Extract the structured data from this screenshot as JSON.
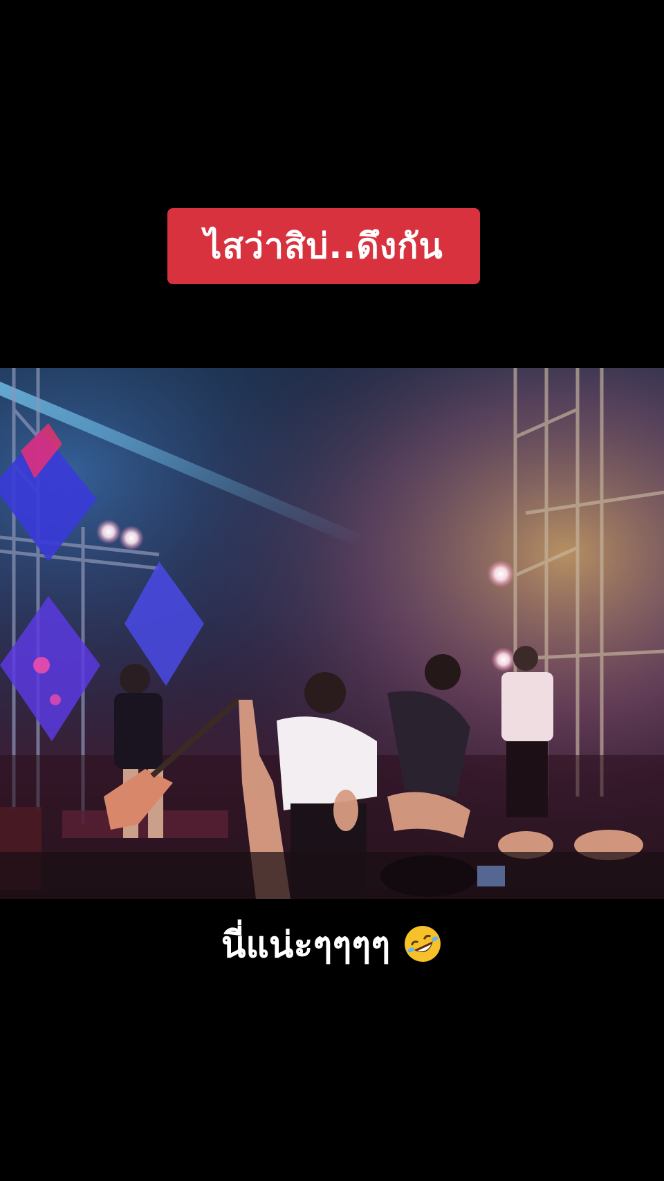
{
  "overlay": {
    "top_caption": "ไสว่าสิบ่..ดึงกัน",
    "bottom_caption": "นี่แน่ะๆๆๆๆ",
    "bottom_emoji": "rolling-on-floor-laughing-icon"
  },
  "colors": {
    "background": "#000000",
    "caption_box": "#d8323f",
    "caption_text": "#ffffff",
    "emoji": "#f7c12a"
  }
}
